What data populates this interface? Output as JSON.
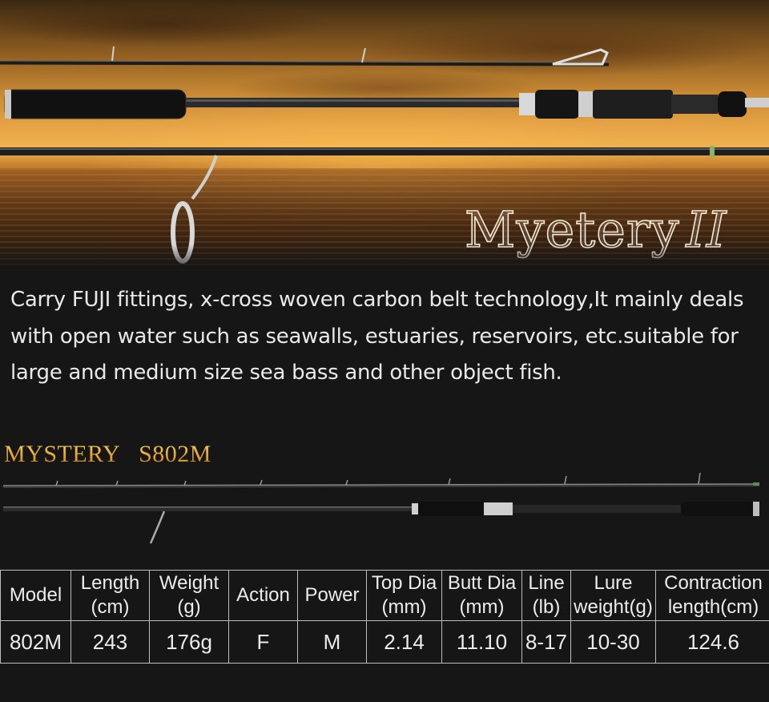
{
  "hero": {
    "title": "Myetery",
    "title_suffix": "II"
  },
  "description": "Carry FUJI fittings, x-cross woven carbon belt technology,It mainly deals with open water such as seawalls, estuaries, reservoirs, etc.suitable for large and medium size sea bass and other object fish.",
  "model_title": "MYSTERY   S802M",
  "specs": {
    "headers": [
      "Model",
      "Length\n(cm)",
      "Weight\n(g)",
      "Action",
      "Power",
      "Top Dia\n(mm)",
      "Butt Dia\n(mm)",
      "Line\n(lb)",
      "Lure\nweight(g)",
      "Contraction\nlength(cm)"
    ],
    "row": [
      "802M",
      "243",
      "176g",
      "F",
      "M",
      "2.14",
      "11.10",
      "8-17",
      "10-30",
      "124.6"
    ]
  },
  "colors": {
    "background": "#161616",
    "gold_title": "#e8b035",
    "table_border": "#bdbdbd"
  }
}
